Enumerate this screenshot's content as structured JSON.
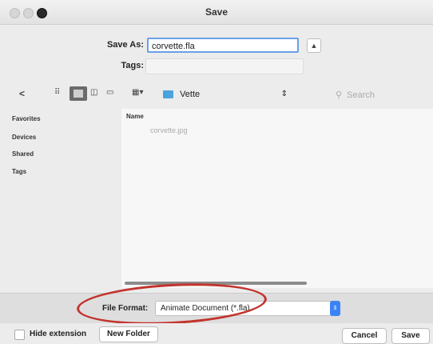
{
  "window": {
    "title": "Save"
  },
  "save_as": {
    "label": "Save As:",
    "value": "corvette.fla"
  },
  "tags": {
    "label": "Tags:"
  },
  "toolbar": {
    "back_glyph": "<",
    "location": "Vette",
    "search_placeholder": "Search"
  },
  "sidebar": {
    "items": [
      "Favorites",
      "Devices",
      "Shared",
      "Tags"
    ]
  },
  "files": {
    "column_name": "Name",
    "items": [
      "corvette.jpg"
    ]
  },
  "file_format": {
    "label": "File Format:",
    "value": "Animate Document (*.fla)"
  },
  "bottom": {
    "hide_extension": "Hide extension",
    "new_folder": "New Folder",
    "cancel": "Cancel",
    "save": "Save"
  },
  "colors": {
    "accent": "#3b83f7",
    "highlight_oval": "#c3332d"
  }
}
